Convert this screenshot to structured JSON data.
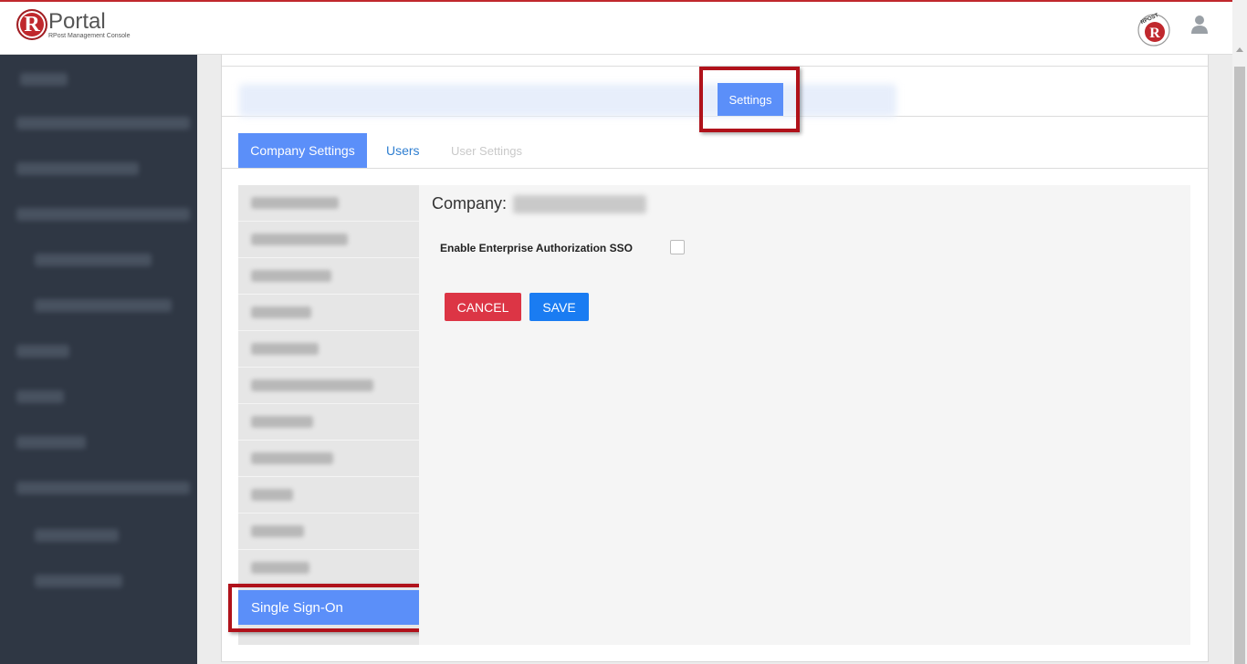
{
  "header": {
    "logo_letter": "R",
    "logo_title": "Portal",
    "logo_subtitle": "RPost Management Console",
    "badge_text": "RPOST",
    "badge_letter": "R"
  },
  "top_tabs": {
    "active_label": "Settings"
  },
  "sub_tabs": [
    {
      "label": "Company Settings",
      "state": "active"
    },
    {
      "label": "Users",
      "state": "link"
    },
    {
      "label": "User Settings",
      "state": "disabled"
    }
  ],
  "left_menu": {
    "active_label": "Single Sign-On"
  },
  "main": {
    "company_label": "Company:",
    "sso_label": "Enable Enterprise Authorization SSO",
    "sso_checked": false,
    "cancel_label": "CANCEL",
    "save_label": "SAVE"
  },
  "colors": {
    "accent_blue": "#5b8ff9",
    "save_blue": "#1a7cf2",
    "cancel_red": "#dc3545",
    "highlight_red": "#b0121b",
    "sidebar_bg": "#2f3744",
    "brand_red": "#c0282d"
  }
}
